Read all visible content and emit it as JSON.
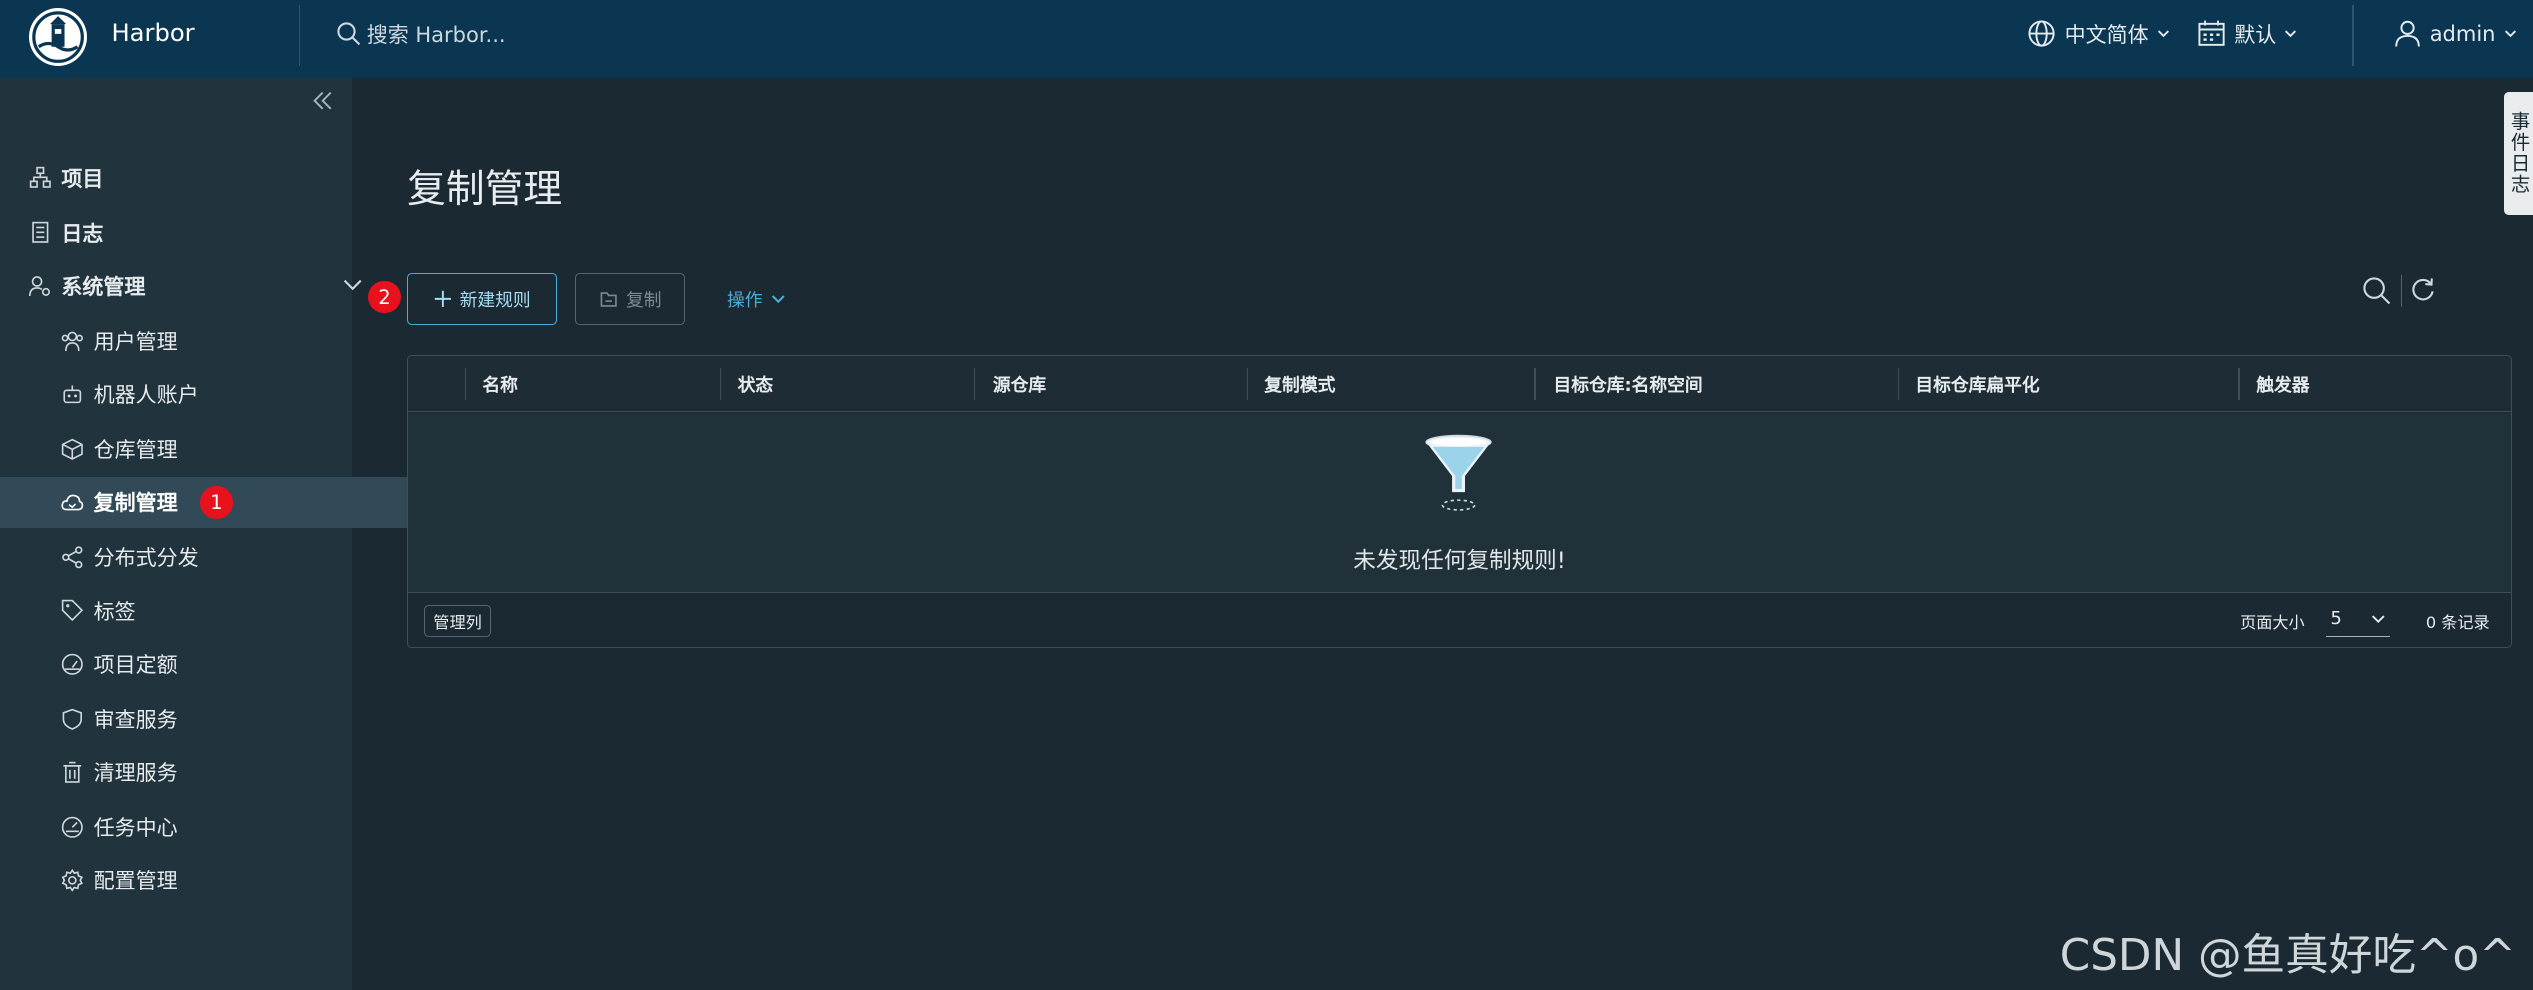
{
  "header": {
    "brand": "Harbor",
    "search_placeholder": "搜索 Harbor...",
    "language": "中文简体",
    "date_format": "默认",
    "user": "admin"
  },
  "sidebar": {
    "items": [
      {
        "label": "项目",
        "icon": "project-icon"
      },
      {
        "label": "日志",
        "icon": "log-icon"
      },
      {
        "label": "系统管理",
        "icon": "admin-icon"
      },
      {
        "label": "用户管理",
        "icon": "users-icon"
      },
      {
        "label": "机器人账户",
        "icon": "robot-icon"
      },
      {
        "label": "仓库管理",
        "icon": "box-icon"
      },
      {
        "label": "复制管理",
        "icon": "cloud-sync-icon"
      },
      {
        "label": "分布式分发",
        "icon": "share-icon"
      },
      {
        "label": "标签",
        "icon": "tag-icon"
      },
      {
        "label": "项目定额",
        "icon": "gauge-icon"
      },
      {
        "label": "审查服务",
        "icon": "shield-icon"
      },
      {
        "label": "清理服务",
        "icon": "trash-icon"
      },
      {
        "label": "任务中心",
        "icon": "dashboard-icon"
      },
      {
        "label": "配置管理",
        "icon": "gear-icon"
      }
    ],
    "active_badge": "1"
  },
  "main": {
    "title": "复制管理",
    "toolbar_badge": "2",
    "new_rule_label": "新建规则",
    "copy_label": "复制",
    "ops_label": "操作"
  },
  "grid": {
    "columns": [
      "名称",
      "状态",
      "源仓库",
      "复制模式",
      "目标仓库:名称空间",
      "目标仓库扁平化",
      "触发器"
    ],
    "empty_text": "未发现任何复制规则!",
    "manage_columns": "管理列",
    "page_size_label": "页面大小",
    "page_size": "5",
    "records": "0 条记录"
  },
  "event_log": "事件日志",
  "watermark": "CSDN @鱼真好吃^o^",
  "colors": {
    "header_bg": "#0a3651",
    "sidebar_bg": "#21333c",
    "content_bg": "#1b2a32",
    "accent": "#49afd9",
    "badge_red": "#e8121e"
  }
}
